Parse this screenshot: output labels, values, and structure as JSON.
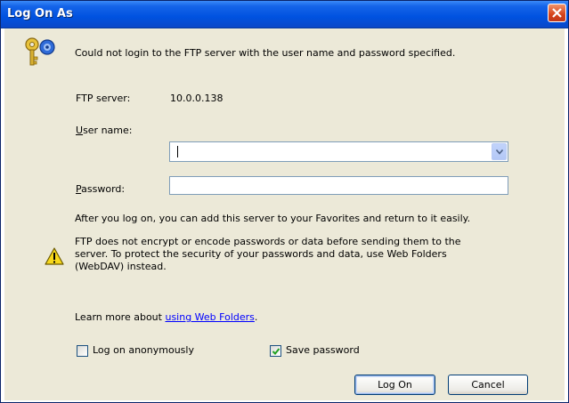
{
  "window": {
    "title": "Log On As"
  },
  "message": "Could not login to the FTP server with the user name and password specified.",
  "server": {
    "label": "FTP server:",
    "value": "10.0.0.138"
  },
  "username": {
    "label": "User name:",
    "value": ""
  },
  "password": {
    "label": "Password:",
    "value": ""
  },
  "info_text": "After you log on, you can add this server to your Favorites and return to it easily.",
  "warning": {
    "line1": "FTP does not encrypt or encode passwords or data before sending them to the",
    "line2": "server.  To protect the security of your passwords and data, use Web Folders",
    "line3": "(WebDAV) instead."
  },
  "learn_more": {
    "prefix": "Learn more about ",
    "link": "using Web Folders",
    "suffix": "."
  },
  "anonymous": {
    "label": "Log on anonymously",
    "checked": false
  },
  "save_password": {
    "label": "Save password",
    "checked": true
  },
  "buttons": {
    "logon": "Log On",
    "cancel": "Cancel"
  },
  "colors": {
    "titlebar": "#0052e0",
    "dialog_bg": "#ece9d8",
    "link": "#0000ff"
  }
}
